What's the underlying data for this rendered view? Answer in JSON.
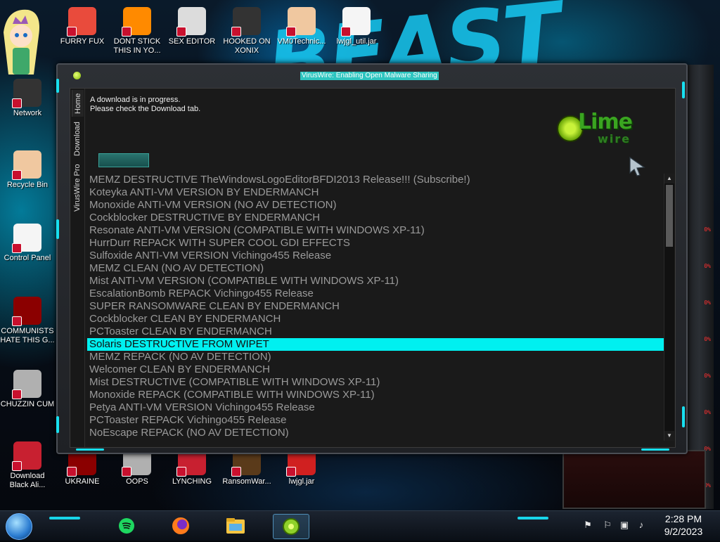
{
  "desktop": {
    "wallpaper_text": "BEAST",
    "icons_top": [
      {
        "label": "FURRY FUX",
        "icon": "firefox-icon"
      },
      {
        "label": "DONT STICK THIS IN YO...",
        "icon": "vlc-cone-icon"
      },
      {
        "label": "SEX EDITOR",
        "icon": "hxd-editor-icon"
      },
      {
        "label": "HOOKED ON XONIX",
        "icon": "xonix-game-icon"
      },
      {
        "label": "VM0Technic...",
        "icon": "doctor-icon"
      },
      {
        "label": "lwjgl_util.jar",
        "icon": "java-jar-icon"
      }
    ],
    "icons_left": [
      {
        "label": "Network",
        "icon": "network-icon"
      },
      {
        "label": "Recycle Bin",
        "icon": "recycle-bin-icon"
      },
      {
        "label": "Control Panel",
        "icon": "control-panel-icon"
      },
      {
        "label": "COMMUNISTS HATE THIS G...",
        "icon": "money-bag-icon"
      },
      {
        "label": "CHUZZIN CUM",
        "icon": "chuzzle-icon"
      },
      {
        "label": "Download Black Ali...",
        "icon": "black-orb-icon"
      }
    ],
    "icons_bottom": [
      {
        "label": "UKRAINE",
        "icon": "ukraine-icon"
      },
      {
        "label": "OOPS",
        "icon": "oops-icon"
      },
      {
        "label": "LYNCHING",
        "icon": "lynching-icon"
      },
      {
        "label": "RansomWar...",
        "icon": "skull-icon"
      },
      {
        "label": "lwjgl.jar",
        "icon": "java-jar-icon"
      }
    ],
    "side_panel_readouts": [
      "0%",
      "0%",
      "0%",
      "0%",
      "0%",
      "0%",
      "0%",
      "0%"
    ]
  },
  "window": {
    "title": "VirusWire: Enabling Open Malware Sharing",
    "tabs": [
      "Home",
      "Download",
      "VirusWire Pro"
    ],
    "message_line1": "A download is in progress.",
    "message_line2": "Please check the Download tab.",
    "download_button_label": "",
    "logo_text_top": "Lime",
    "logo_text_bottom": "wire",
    "list_items": [
      "MEMZ DESTRUCTIVE TheWindowsLogoEditorBFDI2013 Release!!! (Subscribe!)",
      "Koteyka ANTI-VM VERSION BY ENDERMANCH",
      "Monoxide ANTI-VM VERSION (NO AV DETECTION)",
      "Cockblocker DESTRUCTIVE BY ENDERMANCH",
      "Resonate ANTI-VM VERSION (COMPATIBLE WITH WINDOWS XP-11)",
      "HurrDurr REPACK WITH SUPER COOL GDI EFFECTS",
      "Sulfoxide ANTI-VM VERSION Vichingo455 Release",
      "MEMZ CLEAN (NO AV DETECTION)",
      "Mist ANTI-VM VERSION (COMPATIBLE WITH WINDOWS XP-11)",
      "EscalationBomb REPACK Vichingo455 Release",
      "SUPER RANSOMWARE CLEAN BY ENDERMANCH",
      "Cockblocker CLEAN BY ENDERMANCH",
      "PCToaster CLEAN BY ENDERMANCH",
      "Solaris DESTRUCTIVE FROM WIPET",
      "MEMZ REPACK (NO AV DETECTION)",
      "Welcomer CLEAN BY ENDERMANCH",
      "Mist DESTRUCTIVE (COMPATIBLE WITH WINDOWS XP-11)",
      "Monoxide REPACK (COMPATIBLE WITH WINDOWS XP-11)",
      "Petya ANTI-VM VERSION Vichingo455 Release",
      "PCToaster REPACK Vichingo455 Release",
      "NoEscape REPACK (NO AV DETECTION)"
    ],
    "selected_index": 13
  },
  "taskbar": {
    "pinned": [
      "spotify-icon",
      "firefox-icon",
      "file-explorer-icon",
      "limewire-icon"
    ],
    "active_index": 3,
    "tray": [
      "language-icon",
      "flag-icon",
      "network-icon",
      "volume-icon"
    ],
    "time": "2:28 PM",
    "date": "9/2/2023"
  },
  "colors": {
    "accent_cyan": "#00f0f0",
    "list_text": "#9a9a9a",
    "lime_green": "#3aa520"
  }
}
